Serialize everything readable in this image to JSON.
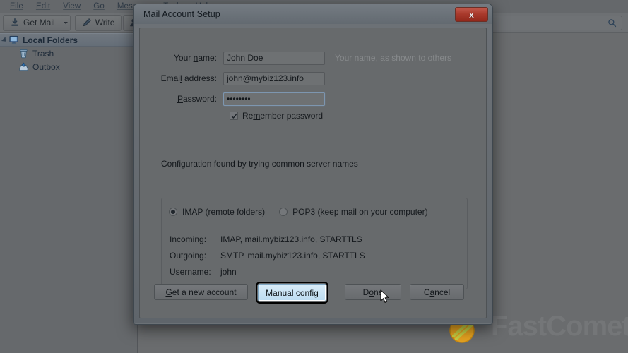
{
  "app": {
    "menu": [
      {
        "label": "File",
        "accel": "F"
      },
      {
        "label": "Edit",
        "accel": "E"
      },
      {
        "label": "View",
        "accel": "V"
      },
      {
        "label": "Go",
        "accel": "G"
      },
      {
        "label": "Message",
        "accel": "M"
      },
      {
        "label": "Tools",
        "accel": "T"
      },
      {
        "label": "Help",
        "accel": "H"
      }
    ],
    "toolbar": {
      "get_mail_label": "Get Mail",
      "write_label": "Write",
      "get_mail_icon": "download-icon",
      "write_icon": "pencil-icon",
      "address_book_icon": "person-icon",
      "dropdown_icon": "chevron-down-icon"
    },
    "search": {
      "value": "",
      "icon": "search-icon"
    },
    "folders": [
      {
        "label": "Local Folders",
        "icon": "computer-icon",
        "selected": true,
        "level": 0
      },
      {
        "label": "Trash",
        "icon": "trash-icon",
        "selected": false,
        "level": 1
      },
      {
        "label": "Outbox",
        "icon": "outbox-icon",
        "selected": false,
        "level": 1
      }
    ]
  },
  "watermark": {
    "text": "FastComet",
    "logo_icon": "comet-icon"
  },
  "dialog": {
    "title": "Mail Account Setup",
    "close_icon": "close-icon",
    "close_label": "x",
    "fields": [
      {
        "label_pre": "Your ",
        "label_accel": "n",
        "label_post": "ame:",
        "value": "John Doe",
        "hint": "Your name, as shown to others",
        "focused": false
      },
      {
        "label_pre": "Emai",
        "label_accel": "l",
        "label_post": " address:",
        "value": "john@mybiz123.info",
        "hint": "",
        "focused": false
      },
      {
        "label_pre": "",
        "label_accel": "P",
        "label_post": "assword:",
        "value": "••••••••",
        "hint": "",
        "focused": true
      }
    ],
    "remember_password": {
      "pre": "Re",
      "accel": "m",
      "post": "ember password",
      "checked": true,
      "icon": "checkmark-icon"
    },
    "status_text": "Configuration found by trying common server names",
    "protocol": {
      "selected": "imap",
      "options": [
        {
          "id": "imap",
          "label": "IMAP (remote folders)",
          "selected": true
        },
        {
          "id": "pop3",
          "label": "POP3 (keep mail on your computer)",
          "selected": false
        }
      ]
    },
    "server_rows": [
      {
        "key": "Incoming:",
        "value": "IMAP, mail.mybiz123.info, STARTTLS"
      },
      {
        "key": "Outgoing:",
        "value": "SMTP, mail.mybiz123.info, STARTTLS"
      },
      {
        "key": "Username:",
        "value": "john"
      }
    ],
    "buttons": [
      {
        "id": "get-new-account",
        "pre": "",
        "accel": "G",
        "post": "et a new account",
        "state": "normal"
      },
      {
        "id": "manual-config",
        "pre": "",
        "accel": "M",
        "post": "anual config",
        "state": "focused"
      },
      {
        "id": "done",
        "pre": "D",
        "accel": "o",
        "post": "ne",
        "state": "default"
      },
      {
        "id": "cancel",
        "pre": "C",
        "accel": "a",
        "post": "ncel",
        "state": "normal"
      }
    ]
  },
  "colors": {
    "dialog_bg": "#676a6c",
    "app_bg": "#6a6c6e",
    "close_red": "#a8392b",
    "focus_blue": "#bcdcf1",
    "text": "#14181c",
    "hint_text": "#878a8c"
  }
}
